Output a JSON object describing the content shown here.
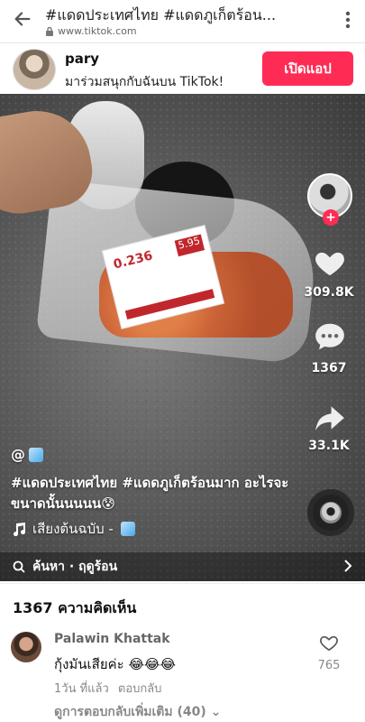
{
  "browser": {
    "title": "#แดดประเทศไทย #แดดภูเก็ตร้อน...",
    "url": "www.tiktok.com"
  },
  "banner": {
    "username": "pary",
    "invite": "มาร่วมสนุกกับฉันบน TikTok!",
    "open_app": "เปิดแอป"
  },
  "video": {
    "sticker_price": "0.236",
    "sticker_tag": "5.95",
    "handle": "@",
    "caption": "#แดดประเทศไทย #แดดภูเก็ตร้อนมาก อะไรจะขนาดนั้นนนนน😰",
    "sound": "เสียงต้นฉบับ -",
    "search": "ค้นหา · ฤดูร้อน",
    "likes": "309.8K",
    "comments": "1367",
    "shares": "33.1K"
  },
  "comments_section": {
    "header": "1367 ความคิดเห็น",
    "items": [
      {
        "name": "Palawin Khattak",
        "text": "กุ้งมันเสียค่ะ 😂😂😂",
        "time": "1วัน ที่แล้ว",
        "reply": "ตอบกลับ",
        "likes": "765",
        "more_replies": "ดูการตอบกลับเพิ่มเติม (40)"
      }
    ]
  },
  "colors": {
    "accent": "#fe2c55"
  }
}
